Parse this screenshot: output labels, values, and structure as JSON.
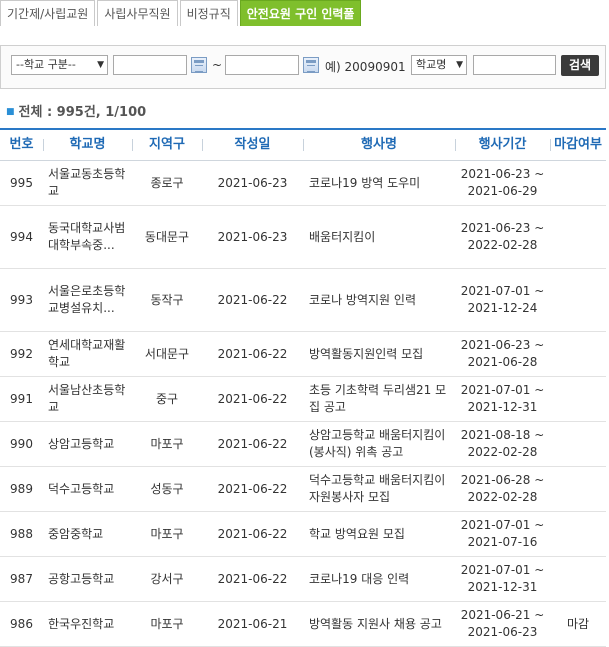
{
  "tabs": [
    {
      "label": "기간제/사립교원",
      "active": false
    },
    {
      "label": "사립사무직원",
      "active": false
    },
    {
      "label": "비정규직",
      "active": false
    },
    {
      "label": "안전요원 구인 인력풀",
      "active": true
    }
  ],
  "search": {
    "school_type_select": "--학교 구분--",
    "date_separator": "~",
    "date_example": "예) 20090901",
    "field_select": "학교명",
    "search_button": "검색"
  },
  "summary": {
    "text": "전체 : 995건, 1/100"
  },
  "table": {
    "headers": [
      "번호",
      "학교명",
      "지역구",
      "작성일",
      "행사명",
      "행사기간",
      "마감여부"
    ],
    "rows": [
      {
        "no": "995",
        "school": "서울교동초등학교",
        "region": "종로구",
        "date": "2021-06-23",
        "title": "코로나19 방역 도우미",
        "start": "2021-06-23 ~",
        "end": "2021-06-29",
        "closed": ""
      },
      {
        "no": "994",
        "school": "동국대학교사범대학부속중...",
        "region": "동대문구",
        "date": "2021-06-23",
        "title": "배움터지킴이",
        "start": "2021-06-23 ~",
        "end": "2022-02-28",
        "closed": ""
      },
      {
        "no": "993",
        "school": "서울은로초등학교병설유치...",
        "region": "동작구",
        "date": "2021-06-22",
        "title": "코로나 방역지원 인력",
        "start": "2021-07-01 ~",
        "end": "2021-12-24",
        "closed": ""
      },
      {
        "no": "992",
        "school": "연세대학교재활학교",
        "region": "서대문구",
        "date": "2021-06-22",
        "title": "방역활동지원인력 모집",
        "start": "2021-06-23 ~",
        "end": "2021-06-28",
        "closed": ""
      },
      {
        "no": "991",
        "school": "서울남산초등학교",
        "region": "중구",
        "date": "2021-06-22",
        "title": "초등 기초학력 두리샘21 모집 공고",
        "start": "2021-07-01 ~",
        "end": "2021-12-31",
        "closed": ""
      },
      {
        "no": "990",
        "school": "상암고등학교",
        "region": "마포구",
        "date": "2021-06-22",
        "title": "상암고등학교 배움터지킴이(봉사직) 위촉 공고",
        "start": "2021-08-18 ~",
        "end": "2022-02-28",
        "closed": ""
      },
      {
        "no": "989",
        "school": "덕수고등학교",
        "region": "성동구",
        "date": "2021-06-22",
        "title": "덕수고등학교 배움터지킴이 자원봉사자 모집",
        "start": "2021-06-28 ~",
        "end": "2022-02-28",
        "closed": ""
      },
      {
        "no": "988",
        "school": "중암중학교",
        "region": "마포구",
        "date": "2021-06-22",
        "title": "학교 방역요원 모집",
        "start": "2021-07-01 ~",
        "end": "2021-07-16",
        "closed": ""
      },
      {
        "no": "987",
        "school": "공항고등학교",
        "region": "강서구",
        "date": "2021-06-22",
        "title": "코로나19 대응 인력",
        "start": "2021-07-01 ~",
        "end": "2021-12-31",
        "closed": ""
      },
      {
        "no": "986",
        "school": "한국우진학교",
        "region": "마포구",
        "date": "2021-06-21",
        "title": "방역활동 지원사 채용 공고",
        "start": "2021-06-21 ~",
        "end": "2021-06-23",
        "closed": "마감"
      }
    ]
  }
}
